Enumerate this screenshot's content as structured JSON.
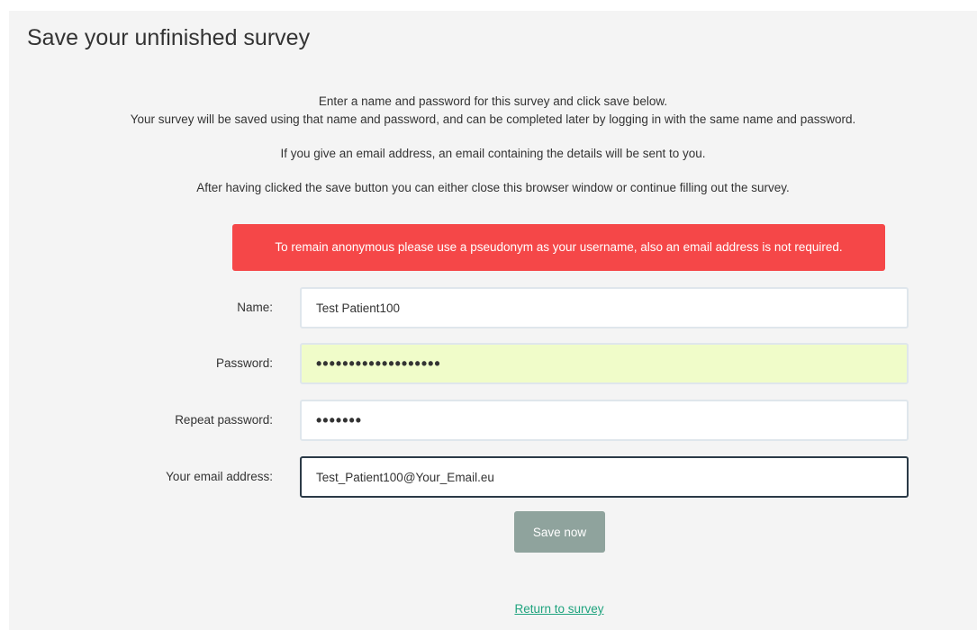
{
  "page": {
    "title": "Save your unfinished survey"
  },
  "intro": {
    "line1": "Enter a name and password for this survey and click save below.",
    "line2": "Your survey will be saved using that name and password, and can be completed later by logging in with the same name and password.",
    "line3": "If you give an email address, an email containing the details will be sent to you.",
    "line4": "After having clicked the save button you can either close this browser window or continue filling out the survey."
  },
  "alert": {
    "text": "To remain anonymous please use a pseudonym as your username, also an email address is not required.",
    "color": "#f54748"
  },
  "form": {
    "name": {
      "label": "Name:",
      "value": "Test Patient100"
    },
    "password": {
      "label": "Password:",
      "value": "•••••••••••••••••••"
    },
    "repeat_password": {
      "label": "Repeat password:",
      "value": "•••••••"
    },
    "email": {
      "label": "Your email address:",
      "value": "Test_Patient100@Your_Email.eu"
    }
  },
  "actions": {
    "save_label": "Save now",
    "return_label": "Return to survey"
  },
  "colors": {
    "background": "#f4f4f4",
    "button": "#8fa39d",
    "link": "#1fa37e",
    "autofill": "#f0fcc9"
  }
}
